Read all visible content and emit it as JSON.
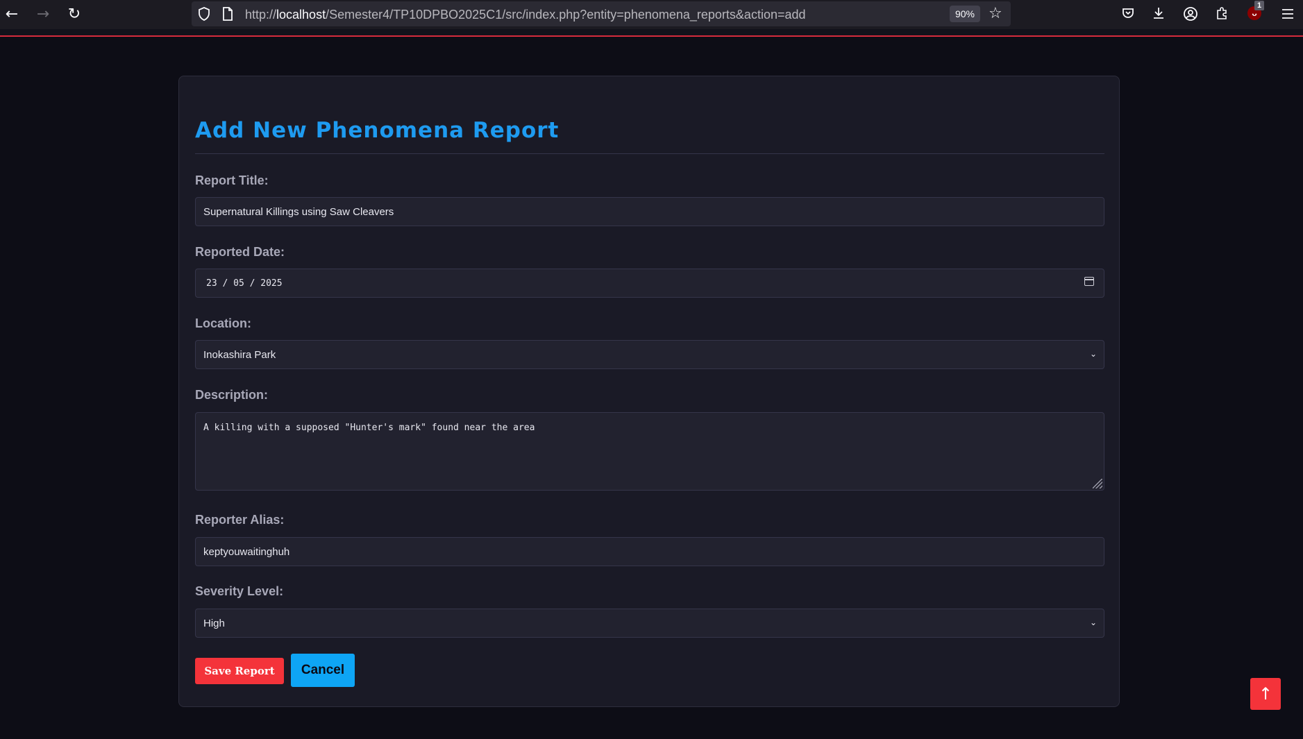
{
  "browser": {
    "back_icon": "←",
    "forward_icon": "→",
    "reload_icon": "↻",
    "url_prefix": "http://",
    "url_host": "localhost",
    "url_path": "/Semester4/TP10DPBO2025C1/src/index.php?entity=phenomena_reports&action=add",
    "zoom": "90%",
    "extension_badge": "1",
    "extension_letter": "ᴗ"
  },
  "form": {
    "title": "Add New Phenomena Report",
    "report_title_label": "Report Title:",
    "report_title_value": "Supernatural Killings using Saw Cleavers",
    "reported_date_label": "Reported Date:",
    "reported_date_value": "23 / 05 / 2025",
    "location_label": "Location:",
    "location_value": "Inokashira Park",
    "description_label": "Description:",
    "description_value": "A killing with a supposed \"Hunter's mark\" found near the area",
    "reporter_alias_label": "Reporter Alias:",
    "reporter_alias_value": "keptyouwaitinghuh",
    "severity_label": "Severity Level:",
    "severity_value": "High",
    "save_label": "Save Report",
    "cancel_label": "Cancel"
  },
  "scroll_top_label": "↑",
  "colors": {
    "accent": "#1e9bf0",
    "danger": "#f4333a",
    "cancel": "#0ea5f5",
    "background": "#0d0d16",
    "card": "#1a1a26"
  }
}
